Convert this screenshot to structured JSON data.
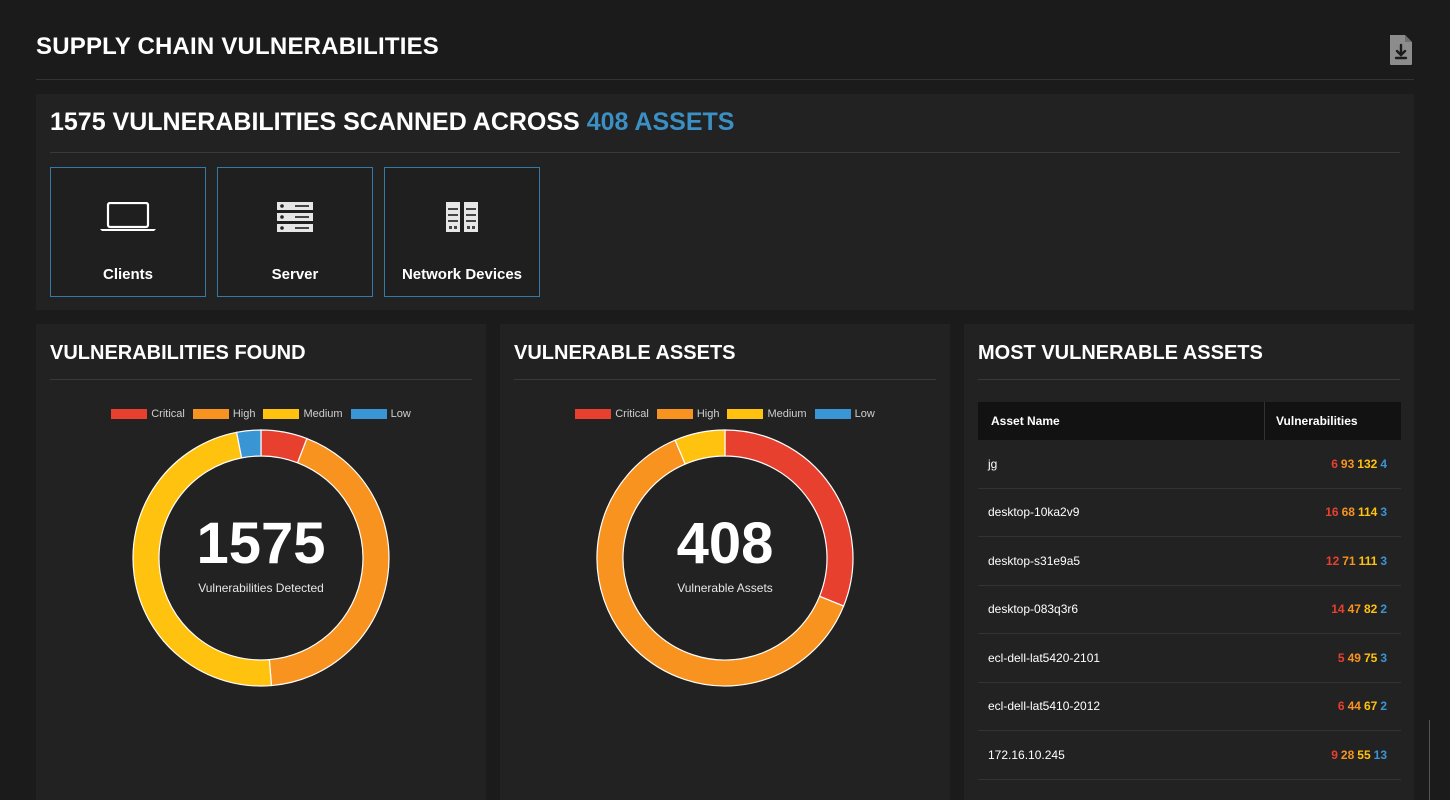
{
  "page": {
    "title": "SUPPLY CHAIN VULNERABILITIES",
    "export_icon": "document-download-icon"
  },
  "summary": {
    "title_prefix": "1575 VULNERABILITIES SCANNED ACROSS",
    "title_accent": "408 ASSETS",
    "tiles": [
      {
        "label": "Clients",
        "icon": "laptop-icon"
      },
      {
        "label": "Server",
        "icon": "server-icon"
      },
      {
        "label": "Network Devices",
        "icon": "network-device-icon"
      }
    ]
  },
  "colors": {
    "critical": "#e8402f",
    "high": "#f7931e",
    "medium": "#ffc20e",
    "low": "#3a95d5",
    "accent": "#3a8fc4",
    "tile_border": "#3579a6"
  },
  "legend": [
    "Critical",
    "High",
    "Medium",
    "Low"
  ],
  "vulnerabilities_card": {
    "title": "VULNERABILITIES FOUND",
    "total": "1575",
    "caption": "Vulnerabilities Detected"
  },
  "assets_card": {
    "title": "VULNERABLE ASSETS",
    "total": "408",
    "caption": "Vulnerable Assets"
  },
  "most_vulnerable": {
    "title": "MOST VULNERABLE ASSETS",
    "col_name": "Asset Name",
    "col_vuln": "Vulnerabilities",
    "rows": [
      {
        "name": "jg",
        "critical": "6",
        "high": "93",
        "medium": "132",
        "low": "4"
      },
      {
        "name": "desktop-10ka2v9",
        "critical": "16",
        "high": "68",
        "medium": "114",
        "low": "3"
      },
      {
        "name": "desktop-s31e9a5",
        "critical": "12",
        "high": "71",
        "medium": "111",
        "low": "3"
      },
      {
        "name": "desktop-083q3r6",
        "critical": "14",
        "high": "47",
        "medium": "82",
        "low": "2"
      },
      {
        "name": "ecl-dell-lat5420-2101",
        "critical": "5",
        "high": "49",
        "medium": "75",
        "low": "3"
      },
      {
        "name": "ecl-dell-lat5410-2012",
        "critical": "6",
        "high": "44",
        "medium": "67",
        "low": "2"
      },
      {
        "name": "172.16.10.245",
        "critical": "9",
        "high": "28",
        "medium": "55",
        "low": "13"
      }
    ]
  },
  "chart_data": [
    {
      "type": "pie",
      "title": "VULNERABILITIES FOUND",
      "categories": [
        "Critical",
        "High",
        "Medium",
        "Low"
      ],
      "values": [
        92,
        675,
        760,
        48
      ],
      "legend_placement": "top"
    },
    {
      "type": "pie",
      "title": "VULNERABLE ASSETS",
      "categories": [
        "Critical",
        "High",
        "Medium",
        "Low"
      ],
      "values": [
        127,
        255,
        26,
        0
      ],
      "legend_placement": "top"
    }
  ]
}
